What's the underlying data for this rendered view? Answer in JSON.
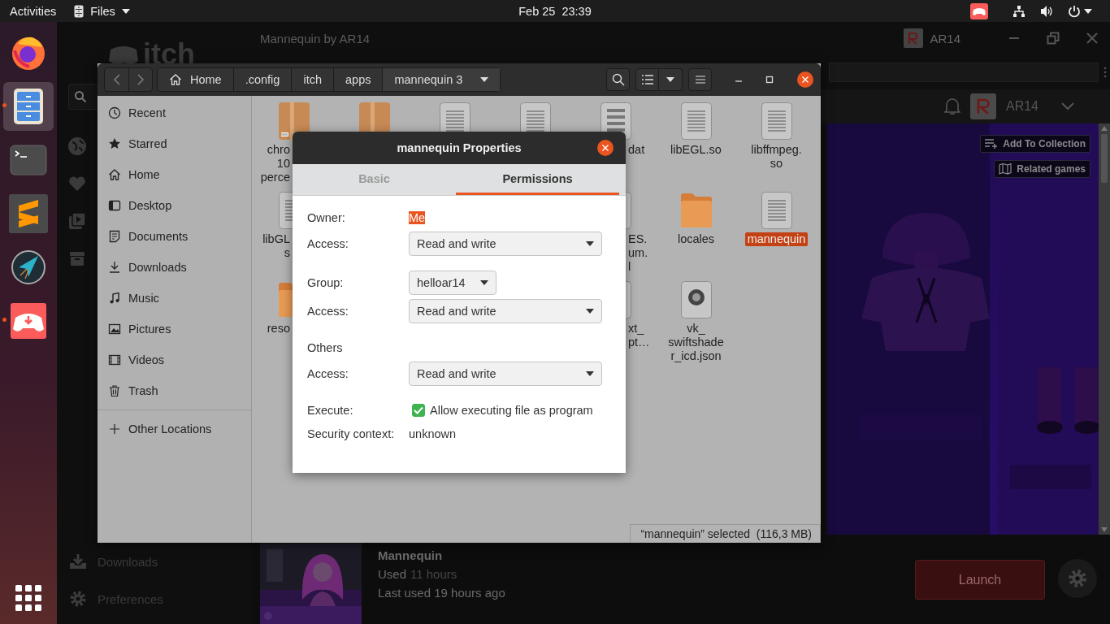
{
  "top_bar": {
    "activities": "Activities",
    "app_menu": "Files",
    "clock": "Feb 25  23:39"
  },
  "dock": {
    "apps": [
      {
        "kind": "firefox",
        "running": false,
        "selected": false
      },
      {
        "kind": "files",
        "running": true,
        "selected": true
      },
      {
        "kind": "terminal",
        "running": false,
        "selected": false
      },
      {
        "kind": "sublime",
        "running": false,
        "selected": false
      },
      {
        "kind": "kite",
        "running": false,
        "selected": false
      },
      {
        "kind": "itch",
        "running": true,
        "selected": false
      }
    ]
  },
  "itch_window": {
    "title": "Mannequin by AR14",
    "logo": "itch",
    "title_user": "AR14",
    "header_user": "AR14",
    "sidebar_bottom": [
      {
        "kind": "downloads",
        "label": "Downloads"
      },
      {
        "kind": "preferences",
        "label": "Preferences"
      }
    ],
    "page_buttons": [
      {
        "kind": "collection",
        "label": "Add To Collection"
      },
      {
        "kind": "related",
        "label": "Related games"
      }
    ],
    "game": {
      "title": "Mannequin",
      "used_label": "Used",
      "used_value": "11 hours",
      "last_used": "Last used 19 hours ago",
      "launch": "Launch"
    }
  },
  "files_window": {
    "path": [
      {
        "label": "Home",
        "kind": "home",
        "selected": false
      },
      {
        "label": ".config",
        "kind": "folder",
        "selected": false
      },
      {
        "label": "itch",
        "kind": "folder",
        "selected": false
      },
      {
        "label": "apps",
        "kind": "folder",
        "selected": false
      },
      {
        "label": "mannequin 3",
        "kind": "folder",
        "selected": true
      }
    ],
    "sidebar": [
      {
        "kind": "recent",
        "label": "Recent"
      },
      {
        "kind": "starred",
        "label": "Starred"
      },
      {
        "kind": "home",
        "label": "Home"
      },
      {
        "kind": "desktop",
        "label": "Desktop"
      },
      {
        "kind": "documents",
        "label": "Documents"
      },
      {
        "kind": "downloads",
        "label": "Downloads"
      },
      {
        "kind": "music",
        "label": "Music"
      },
      {
        "kind": "pictures",
        "label": "Pictures"
      },
      {
        "kind": "videos",
        "label": "Videos"
      },
      {
        "kind": "trash",
        "label": "Trash"
      }
    ],
    "other_locations": "Other Locations",
    "file_rows": [
      [
        {
          "kind": "package",
          "selected": false,
          "lines": [
            "chro",
            "10",
            "perce"
          ]
        },
        {
          "kind": "package"
        },
        {
          "kind": "document"
        },
        {
          "kind": "document"
        },
        {
          "kind": "binary",
          "selected": false,
          "lines": [
            "dat"
          ]
        },
        {
          "kind": "document",
          "selected": false,
          "lines": [
            "libEGL.so"
          ]
        },
        {
          "kind": "document",
          "selected": false,
          "lines": [
            "libffmpeg.",
            "so"
          ]
        }
      ],
      [
        {
          "kind": "document",
          "selected": false,
          "lines": [
            "libGL",
            "s"
          ]
        },
        {
          "kind": "hidden"
        },
        {
          "kind": "hidden"
        },
        {
          "kind": "hidden"
        },
        {
          "kind": "document",
          "selected": false,
          "lines": [
            "ES.",
            "um.",
            "l"
          ]
        },
        {
          "kind": "folder",
          "selected": false,
          "lines": [
            "locales"
          ]
        },
        {
          "kind": "document",
          "selected": true,
          "lines": [
            "mannequin"
          ]
        }
      ],
      [
        {
          "kind": "folder",
          "selected": false,
          "lines": [
            "reso"
          ]
        },
        {
          "kind": "hidden"
        },
        {
          "kind": "hidden"
        },
        {
          "kind": "hidden"
        },
        {
          "kind": "document",
          "selected": false,
          "lines": [
            "xt_",
            "pt…"
          ]
        },
        {
          "kind": "json",
          "selected": false,
          "lines": [
            "vk_",
            "swiftshade",
            "r_icd.json"
          ]
        }
      ]
    ],
    "status": "“mannequin” selected  (116,3 MB)"
  },
  "dialog": {
    "title": "mannequin Properties",
    "tabs": [
      {
        "label": "Basic",
        "selected": false
      },
      {
        "label": "Permissions",
        "selected": true
      }
    ],
    "sections": [
      [
        {
          "kind": "text",
          "label": "Owner:",
          "value": "Me",
          "selected": true
        },
        {
          "kind": "select",
          "label": "Access:",
          "value": "Read and write"
        }
      ],
      [
        {
          "kind": "picker",
          "label": "Group:",
          "value": "helloar14"
        },
        {
          "kind": "select",
          "label": "Access:",
          "value": "Read and write"
        }
      ],
      [
        {
          "kind": "heading",
          "label": "Others"
        },
        {
          "kind": "select",
          "label": "Access:",
          "value": "Read and write"
        }
      ],
      [
        {
          "kind": "checkbox",
          "label": "Execute:",
          "value": "Allow executing file as program",
          "checked": true
        },
        {
          "kind": "text",
          "label": "Security context:",
          "value": "unknown",
          "selected": false
        }
      ]
    ]
  }
}
